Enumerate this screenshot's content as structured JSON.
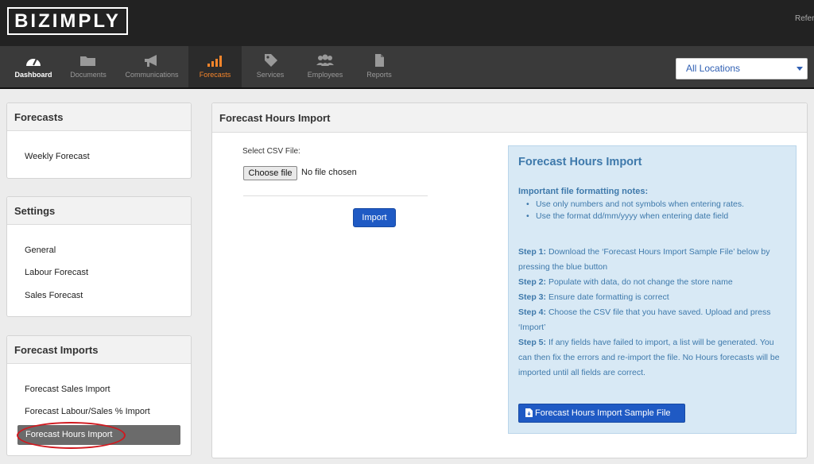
{
  "app": {
    "logo": "BIZIMPLY",
    "refer": "Refer"
  },
  "nav": {
    "items": [
      {
        "label": "Dashboard",
        "icon": "dashboard-icon"
      },
      {
        "label": "Documents",
        "icon": "folder-icon"
      },
      {
        "label": "Communications",
        "icon": "megaphone-icon"
      },
      {
        "label": "Forecasts",
        "icon": "bar-chart-icon"
      },
      {
        "label": "Services",
        "icon": "tag-icon"
      },
      {
        "label": "Employees",
        "icon": "people-icon"
      },
      {
        "label": "Reports",
        "icon": "document-icon"
      }
    ],
    "active": "Forecasts",
    "accent": "#f5852b"
  },
  "location": {
    "selected": "All Locations"
  },
  "sidebar": {
    "forecasts": {
      "title": "Forecasts",
      "items": [
        "Weekly Forecast"
      ]
    },
    "settings": {
      "title": "Settings",
      "items": [
        "General",
        "Labour Forecast",
        "Sales Forecast"
      ]
    },
    "imports": {
      "title": "Forecast Imports",
      "items": [
        "Forecast Sales Import",
        "Forecast Labour/Sales % Import",
        "Forecast Hours Import"
      ],
      "active": "Forecast Hours Import"
    }
  },
  "main": {
    "title": "Forecast Hours Import",
    "csv_label": "Select CSV File:",
    "choose_file": "Choose file",
    "no_file": "No file chosen",
    "import_button": "Import"
  },
  "info": {
    "title": "Forecast Hours Import",
    "subtitle": "Important file formatting notes:",
    "bullets": [
      "Use only numbers and not symbols when entering rates.",
      "Use the format dd/mm/yyyy when entering date field"
    ],
    "steps": [
      {
        "label": "Step 1:",
        "text": "Download the ‘Forecast Hours Import Sample File’ below by pressing the blue button"
      },
      {
        "label": "Step 2:",
        "text": "Populate with data, do not change the store name"
      },
      {
        "label": "Step 3:",
        "text": "Ensure date formatting is correct"
      },
      {
        "label": "Step 4:",
        "text": "Choose the CSV file that you have saved. Upload and press ‘Import’"
      },
      {
        "label": "Step 5:",
        "text": "If any fields have failed to import, a list will be generated. You can then fix the errors and re-import the file. No Hours forecasts will be imported until all fields are correct."
      }
    ],
    "sample_button": "Forecast Hours Import Sample File"
  }
}
